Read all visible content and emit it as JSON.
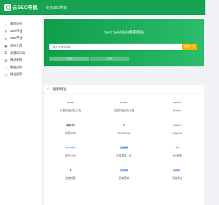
{
  "header": {
    "logo_text": "云SEO导航",
    "slogan": "专注SEO导航"
  },
  "sidebar": {
    "items": [
      {
        "label": "最新站点",
        "icon": "home-icon"
      },
      {
        "label": "SEO平台",
        "icon": "platform-icon"
      },
      {
        "label": "SEM平台",
        "icon": "platform-icon"
      },
      {
        "label": "站长工具",
        "icon": "tool-icon"
      },
      {
        "label": "关键词工具",
        "icon": "key-icon"
      },
      {
        "label": "网站系统",
        "icon": "system-icon"
      },
      {
        "label": "数据分析",
        "icon": "chart-icon"
      },
      {
        "label": "网址提审",
        "icon": "submit-icon"
      }
    ]
  },
  "hero": {
    "title": "SEO SEM站内搜索网站",
    "search_placeholder": "输入关键字搜索",
    "search_button": "搜索一下",
    "tabs": [
      "2024",
      "2025"
    ]
  },
  "section": {
    "title": "最新网址"
  },
  "sites": [
    {
      "label": "谷歌外链优化工具",
      "logo_text": "Ahrefs",
      "logo_color": "#1a3a7a"
    },
    {
      "label": "百度外链分析工具",
      "logo_text": "BAIDU",
      "logo_color": "#2e66e0"
    },
    {
      "label": "Discuz!",
      "logo_text": "Discuz!",
      "logo_color": "#1a5fa8"
    },
    {
      "label": "帝国CMS",
      "logo_text": "帝国CMS",
      "logo_color": "#333333"
    },
    {
      "label": "WordPress",
      "logo_text": "W",
      "logo_color": "#21759b"
    },
    {
      "label": "phpcms",
      "logo_text": "phpcms",
      "logo_color": "#2b7cc7"
    },
    {
      "label": "易优CMS",
      "logo_text": "EyouCMS",
      "logo_color": "#1e88e5"
    },
    {
      "label": "百度搜索 - 站",
      "logo_text": "百度搜索",
      "logo_color": "#2e66e0"
    },
    {
      "label": "360搜索",
      "logo_text": "360",
      "logo_color": "#2aa34a"
    },
    {
      "label": "金陵搜索",
      "logo_text": "⬢",
      "logo_color": "#1fa146"
    },
    {
      "label": "百度营销",
      "logo_text": "百度营销",
      "logo_color": "#2e66e0"
    },
    {
      "label": "百度竞价",
      "logo_text": "百度推广",
      "logo_color": "#2e66e0"
    }
  ]
}
